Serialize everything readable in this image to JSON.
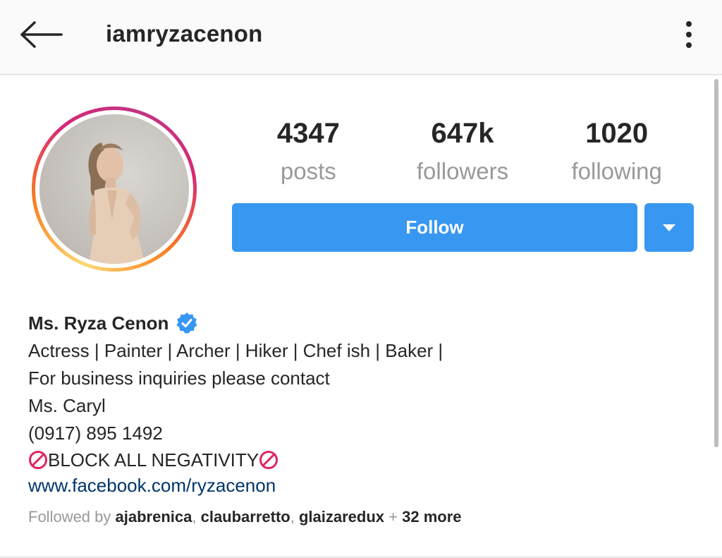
{
  "header": {
    "username": "iamryzacenon"
  },
  "stats": {
    "posts": {
      "value": "4347",
      "label": "posts"
    },
    "followers": {
      "value": "647k",
      "label": "followers"
    },
    "following": {
      "value": "1020",
      "label": "following"
    }
  },
  "actions": {
    "follow_label": "Follow"
  },
  "bio": {
    "name": "Ms. Ryza Cenon",
    "lines": [
      "Actress | Painter | Archer | Hiker | Chef ish | Baker |",
      "For business inquiries please contact",
      "Ms. Caryl",
      "(0917) 895 1492"
    ],
    "block_text": "BLOCK ALL NEGATIVITY",
    "link": "www.facebook.com/ryzacenon"
  },
  "followed_by": {
    "prefix": "Followed by ",
    "accounts": [
      "ajabrenica",
      "claubarretto",
      "glaizaredux"
    ],
    "more": "32 more"
  },
  "colors": {
    "accent": "#3897f0",
    "link": "#003569",
    "verified": "#3897f0",
    "muted": "#999999"
  },
  "icons": {
    "back": "arrow-left-icon",
    "more": "vertical-dots-icon",
    "verified": "verified-badge-icon",
    "dropdown": "caret-down-icon",
    "no_sign": "prohibited-icon"
  }
}
